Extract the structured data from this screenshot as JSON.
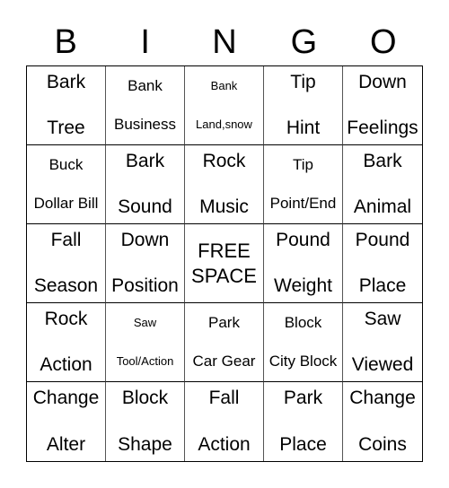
{
  "header": [
    "B",
    "I",
    "N",
    "G",
    "O"
  ],
  "cells": [
    {
      "top": "Bark",
      "bottom": "Tree",
      "size": "n"
    },
    {
      "top": "Bank",
      "bottom": "Business",
      "size": "s"
    },
    {
      "top": "Bank",
      "bottom": "Land,snow",
      "size": "tiny"
    },
    {
      "top": "Tip",
      "bottom": "Hint",
      "size": "n"
    },
    {
      "top": "Down",
      "bottom": "Feelings",
      "size": "n"
    },
    {
      "top": "Buck",
      "bottom": "Dollar Bill",
      "size": "s"
    },
    {
      "top": "Bark",
      "bottom": "Sound",
      "size": "n"
    },
    {
      "top": "Rock",
      "bottom": "Music",
      "size": "n"
    },
    {
      "top": "Tip",
      "bottom": "Point/End",
      "size": "s"
    },
    {
      "top": "Bark",
      "bottom": "Animal",
      "size": "n"
    },
    {
      "top": "Fall",
      "bottom": "Season",
      "size": "n"
    },
    {
      "top": "Down",
      "bottom": "Position",
      "size": "n"
    },
    {
      "top": "FREE",
      "bottom": "SPACE",
      "size": "free"
    },
    {
      "top": "Pound",
      "bottom": "Weight",
      "size": "n"
    },
    {
      "top": "Pound",
      "bottom": "Place",
      "size": "n"
    },
    {
      "top": "Rock",
      "bottom": "Action",
      "size": "n"
    },
    {
      "top": "Saw",
      "bottom": "Tool/Action",
      "size": "tiny"
    },
    {
      "top": "Park",
      "bottom": "Car Gear",
      "size": "s"
    },
    {
      "top": "Block",
      "bottom": "City Block",
      "size": "s"
    },
    {
      "top": "Saw",
      "bottom": "Viewed",
      "size": "n"
    },
    {
      "top": "Change",
      "bottom": "Alter",
      "size": "n"
    },
    {
      "top": "Block",
      "bottom": "Shape",
      "size": "n"
    },
    {
      "top": "Fall",
      "bottom": "Action",
      "size": "n"
    },
    {
      "top": "Park",
      "bottom": "Place",
      "size": "n"
    },
    {
      "top": "Change",
      "bottom": "Coins",
      "size": "n"
    }
  ]
}
